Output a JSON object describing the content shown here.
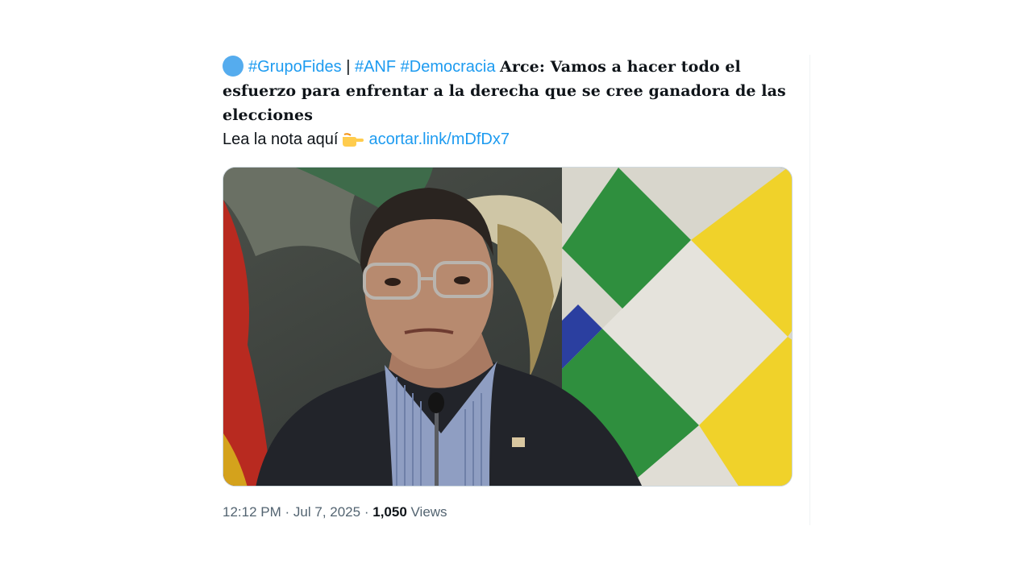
{
  "tweet": {
    "hashtag1": "#GrupoFides",
    "pipe": "|",
    "hashtag2": "#ANF",
    "hashtag3": "#Democracia",
    "headline": "Arce: Vamos a hacer todo el esfuerzo para enfrentar a la derecha que se cree ganadora de las elecciones",
    "read_more": "Lea la nota aquí",
    "link_text": "acortar.link/mDfDx7",
    "link_color": "#1d9bf0"
  },
  "media": {
    "icon": "photo-of-speaker-at-microphone"
  },
  "meta": {
    "time": "12:12 PM",
    "sep1": "·",
    "date": "Jul 7, 2025",
    "sep2": "·",
    "views_count": "1,050",
    "views_label": "Views"
  },
  "colors": {
    "text": "#0f1419",
    "muted": "#536471",
    "accent": "#1d9bf0"
  }
}
